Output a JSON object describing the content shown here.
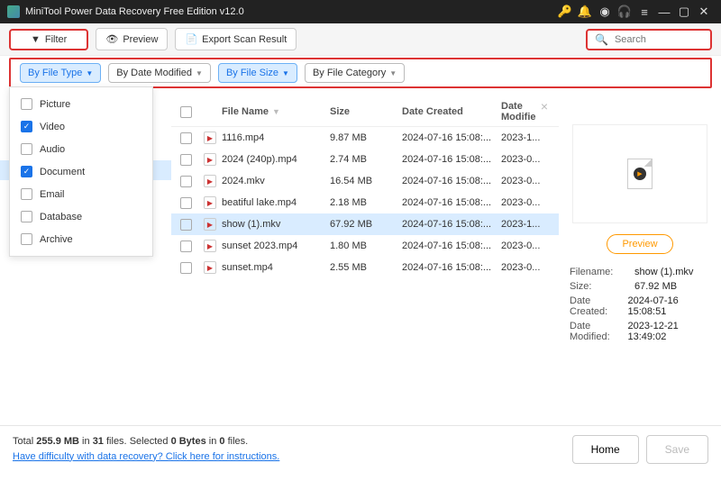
{
  "title": "MiniTool Power Data Recovery Free Edition v12.0",
  "toolbar": {
    "filter": "Filter",
    "preview": "Preview",
    "export": "Export Scan Result"
  },
  "search": {
    "placeholder": "Search"
  },
  "filters": {
    "type": "By File Type",
    "date": "By Date Modified",
    "size": "By File Size",
    "cat": "By File Category"
  },
  "typeDropdown": [
    {
      "label": "Picture",
      "checked": false
    },
    {
      "label": "Video",
      "checked": true
    },
    {
      "label": "Audio",
      "checked": false
    },
    {
      "label": "Document",
      "checked": true
    },
    {
      "label": "Email",
      "checked": false
    },
    {
      "label": "Database",
      "checked": false
    },
    {
      "label": "Archive",
      "checked": false
    }
  ],
  "columns": {
    "name": "File Name",
    "size": "Size",
    "created": "Date Created",
    "modified": "Date Modifie"
  },
  "rows": [
    {
      "name": "1116.mp4",
      "size": "9.87 MB",
      "created": "2024-07-16 15:08:...",
      "modified": "2023-1...",
      "sel": false
    },
    {
      "name": "2024 (240p).mp4",
      "size": "2.74 MB",
      "created": "2024-07-16 15:08:...",
      "modified": "2023-0...",
      "sel": false
    },
    {
      "name": "2024.mkv",
      "size": "16.54 MB",
      "created": "2024-07-16 15:08:...",
      "modified": "2023-0...",
      "sel": false
    },
    {
      "name": "beatiful lake.mp4",
      "size": "2.18 MB",
      "created": "2024-07-16 15:08:...",
      "modified": "2023-0...",
      "sel": false
    },
    {
      "name": "show (1).mkv",
      "size": "67.92 MB",
      "created": "2024-07-16 15:08:...",
      "modified": "2023-1...",
      "sel": true
    },
    {
      "name": "sunset 2023.mp4",
      "size": "1.80 MB",
      "created": "2024-07-16 15:08:...",
      "modified": "2023-0...",
      "sel": false
    },
    {
      "name": "sunset.mp4",
      "size": "2.55 MB",
      "created": "2024-07-16 15:08:...",
      "modified": "2023-0...",
      "sel": false
    }
  ],
  "preview": {
    "button": "Preview",
    "meta": [
      {
        "k": "Filename:",
        "v": "show (1).mkv"
      },
      {
        "k": "Size:",
        "v": "67.92 MB"
      },
      {
        "k": "Date Created:",
        "v": "2024-07-16 15:08:51"
      },
      {
        "k": "Date Modified:",
        "v": "2023-12-21 13:49:02"
      }
    ]
  },
  "footer": {
    "total_pre": "Total ",
    "total_size": "255.9 MB",
    "total_mid": " in ",
    "total_files": "31",
    "total_post": " files.",
    "sel_pre": "  Selected ",
    "sel_bytes": "0 Bytes",
    "sel_mid": " in ",
    "sel_files": "0",
    "sel_post": " files.",
    "help": "Have difficulty with data recovery? Click here for instructions.",
    "home": "Home",
    "save": "Save"
  }
}
